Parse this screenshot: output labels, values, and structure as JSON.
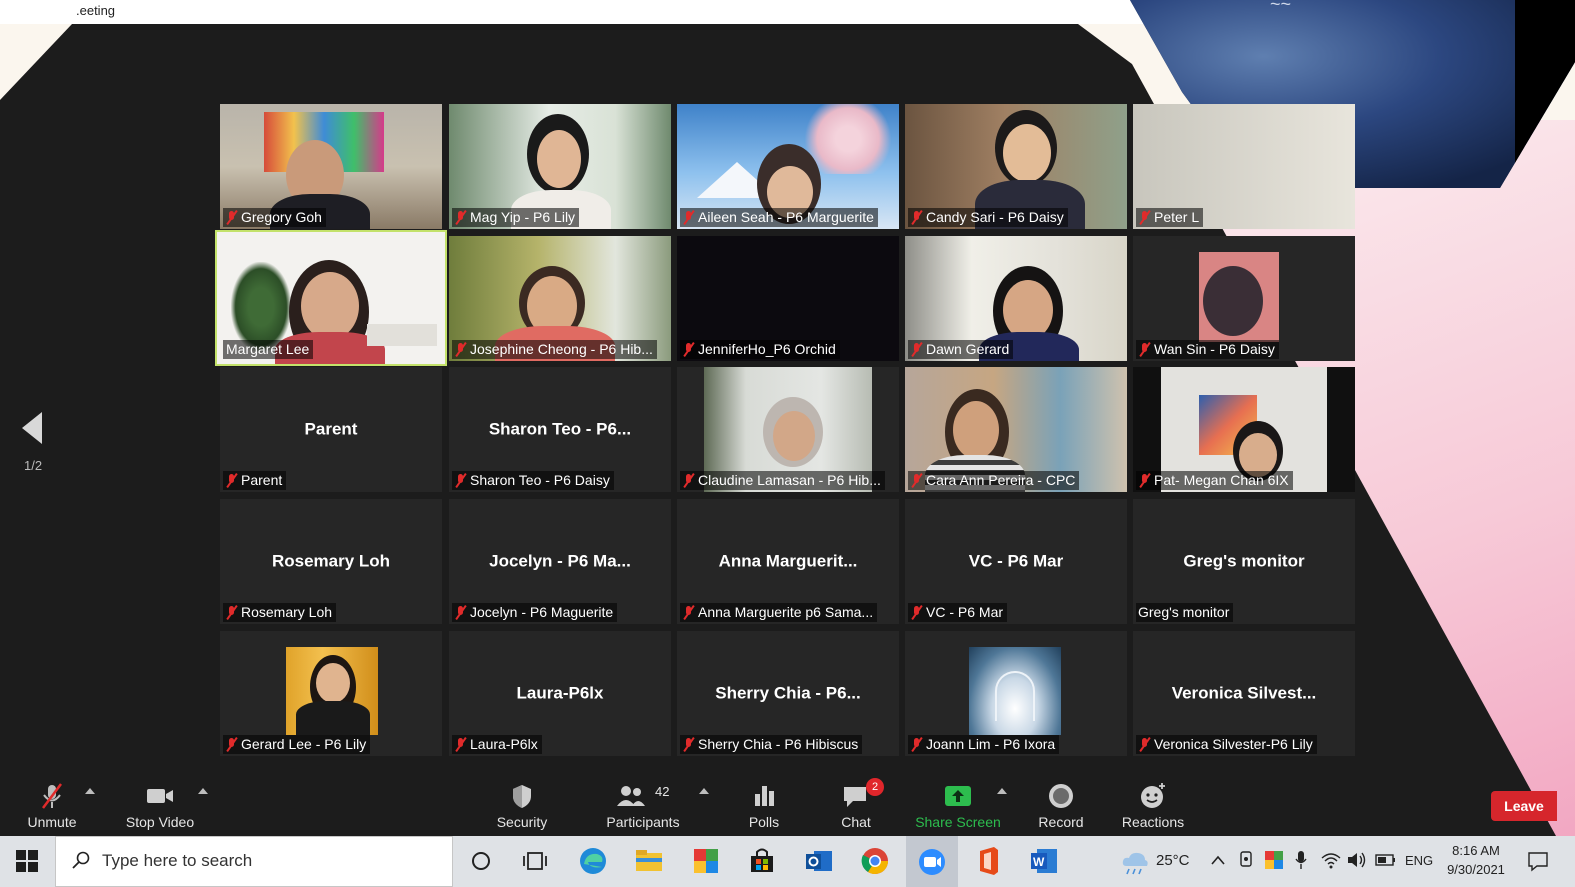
{
  "window": {
    "title_fragment": ".eeting"
  },
  "gallery": {
    "page_indicator": "1/2",
    "tiles": [
      {
        "label": "Gregory Goh",
        "muted": true
      },
      {
        "label": "Mag Yip - P6 Lily",
        "muted": true
      },
      {
        "label": "Aileen Seah - P6 Marguerite",
        "muted": true
      },
      {
        "label": "Candy Sari - P6 Daisy",
        "muted": true
      },
      {
        "label": "Peter L",
        "muted": true
      },
      {
        "label": "Margaret Lee",
        "muted": false,
        "active_speaker": true
      },
      {
        "label": "Josephine Cheong - P6 Hib...",
        "muted": true
      },
      {
        "label": "JenniferHo_P6 Orchid",
        "muted": true
      },
      {
        "label": "Dawn Gerard",
        "muted": true
      },
      {
        "label": "Wan Sin - P6 Daisy",
        "muted": true
      },
      {
        "label": "Parent",
        "center_name": "Parent",
        "muted": true
      },
      {
        "label": "Sharon Teo - P6 Daisy",
        "center_name": "Sharon Teo - P6...",
        "muted": true
      },
      {
        "label": "Claudine Lamasan - P6 Hib...",
        "muted": true
      },
      {
        "label": "Cara Ann Pereira - CPC",
        "muted": true
      },
      {
        "label": "Pat- Megan Chan 6IX",
        "muted": true
      },
      {
        "label": "Rosemary Loh",
        "center_name": "Rosemary Loh",
        "muted": true
      },
      {
        "label": "Jocelyn - P6 Maguerite",
        "center_name": "Jocelyn - P6 Ma...",
        "muted": true
      },
      {
        "label": "Anna Marguerite p6 Sama...",
        "center_name": "Anna Marguerit...",
        "muted": true
      },
      {
        "label": "VC - P6 Mar",
        "center_name": "VC - P6 Mar",
        "muted": true
      },
      {
        "label": "Greg's monitor",
        "center_name": "Greg's monitor",
        "muted": false
      },
      {
        "label": "Gerard Lee - P6 Lily",
        "muted": true
      },
      {
        "label": "Laura-P6lx",
        "center_name": "Laura-P6lx",
        "muted": true
      },
      {
        "label": "Sherry Chia - P6 Hibiscus",
        "center_name": "Sherry Chia - P6...",
        "muted": true
      },
      {
        "label": "Joann Lim - P6 Ixora",
        "muted": true
      },
      {
        "label": "Veronica Silvester-P6 Lily",
        "center_name": "Veronica Silvest...",
        "muted": true
      }
    ]
  },
  "toolbar": {
    "unmute": "Unmute",
    "stop_video": "Stop Video",
    "security": "Security",
    "participants": "Participants",
    "participants_count": "42",
    "polls": "Polls",
    "chat": "Chat",
    "chat_badge": "2",
    "share_screen": "Share Screen",
    "record": "Record",
    "reactions": "Reactions",
    "leave": "Leave",
    "share_color": "#2dbd4e",
    "leave_color": "#d6262c"
  },
  "taskbar": {
    "search_placeholder": "Type here to search",
    "temperature": "25°C",
    "language": "ENG",
    "time": "8:16 AM",
    "date": "9/30/2021",
    "apps": [
      "task-view-icon",
      "edge-icon",
      "file-explorer-icon",
      "photos-icon",
      "store-icon",
      "outlook-icon",
      "chrome-icon",
      "zoom-icon",
      "office-icon",
      "word-icon"
    ]
  }
}
